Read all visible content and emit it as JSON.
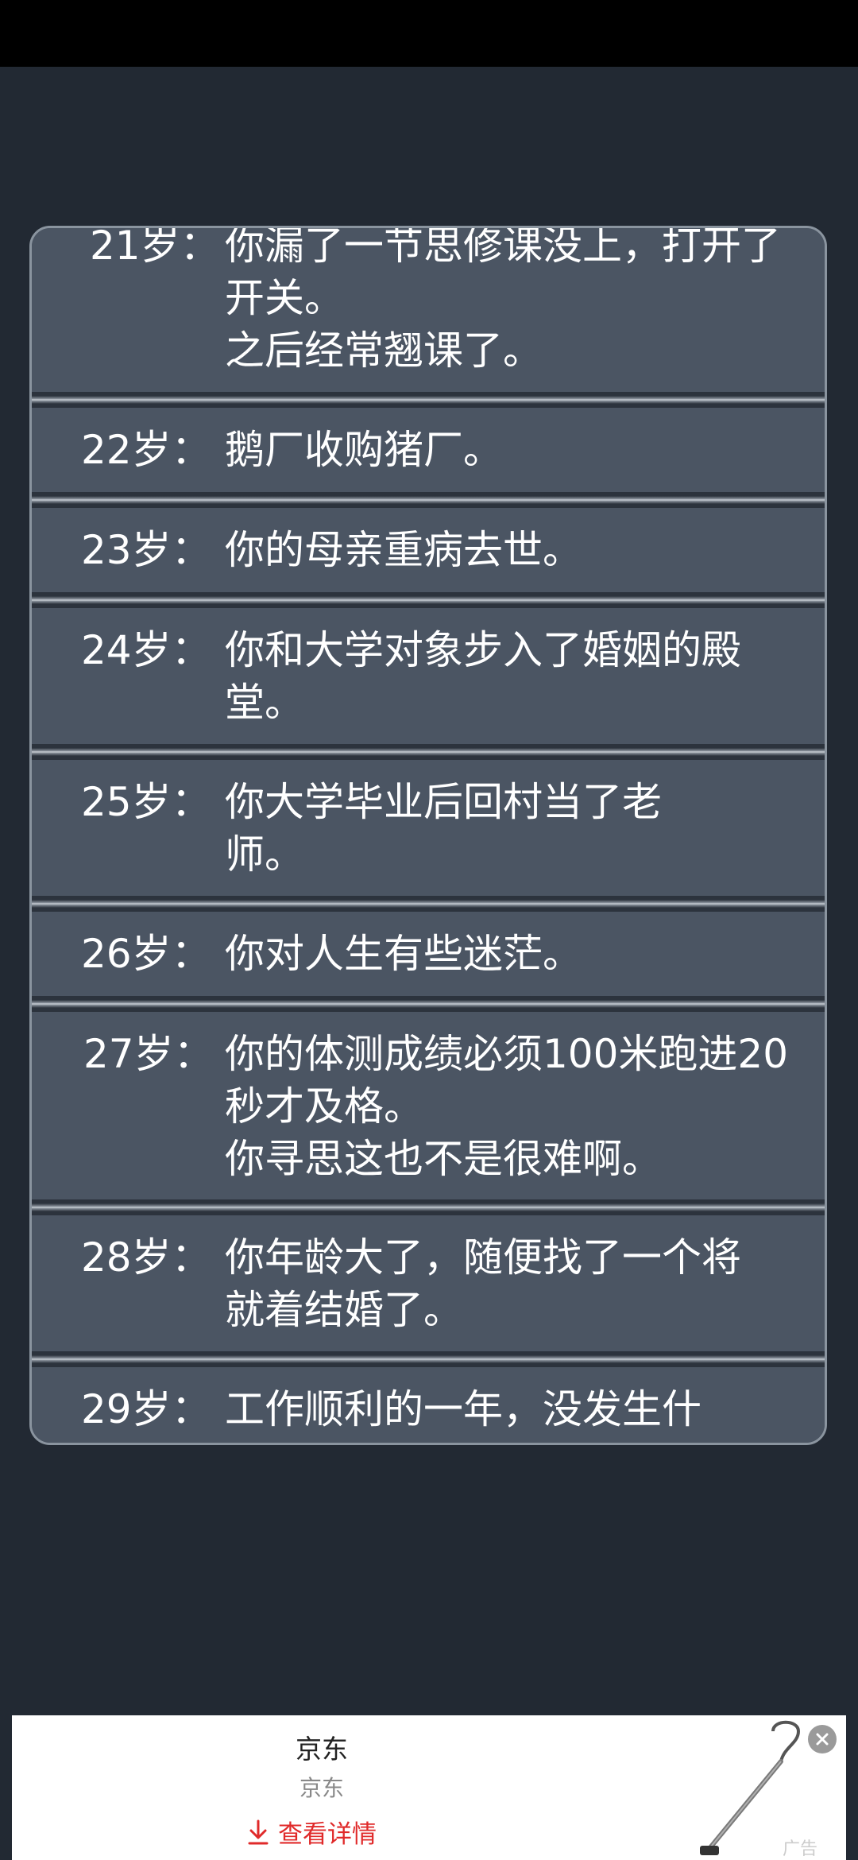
{
  "events": [
    {
      "age": "21岁：",
      "text": "你漏了一节思修课没上，打开了开关。\n之后经常翘课了。"
    },
    {
      "age": "22岁：",
      "text": "鹅厂收购猪厂。"
    },
    {
      "age": "23岁：",
      "text": "你的母亲重病去世。"
    },
    {
      "age": "24岁：",
      "text": "你和大学对象步入了婚姻的殿堂。"
    },
    {
      "age": "25岁：",
      "text": "你大学毕业后回村当了老师。"
    },
    {
      "age": "26岁：",
      "text": "你对人生有些迷茫。"
    },
    {
      "age": "27岁：",
      "text": "你的体测成绩必须100米跑进20秒才及格。\n你寻思这也不是很难啊。"
    },
    {
      "age": "28岁：",
      "text": "你年龄大了，随便找了一个将就着结婚了。"
    },
    {
      "age": "29岁：",
      "text": "工作顺利的一年，没发生什"
    }
  ],
  "ad": {
    "title": "京东",
    "subtitle": "京东",
    "link_label": "查看详情",
    "tag": "广告",
    "link_color": "#e02a2a"
  },
  "icons": {
    "download": "download-arrow-icon",
    "close": "close-icon"
  }
}
